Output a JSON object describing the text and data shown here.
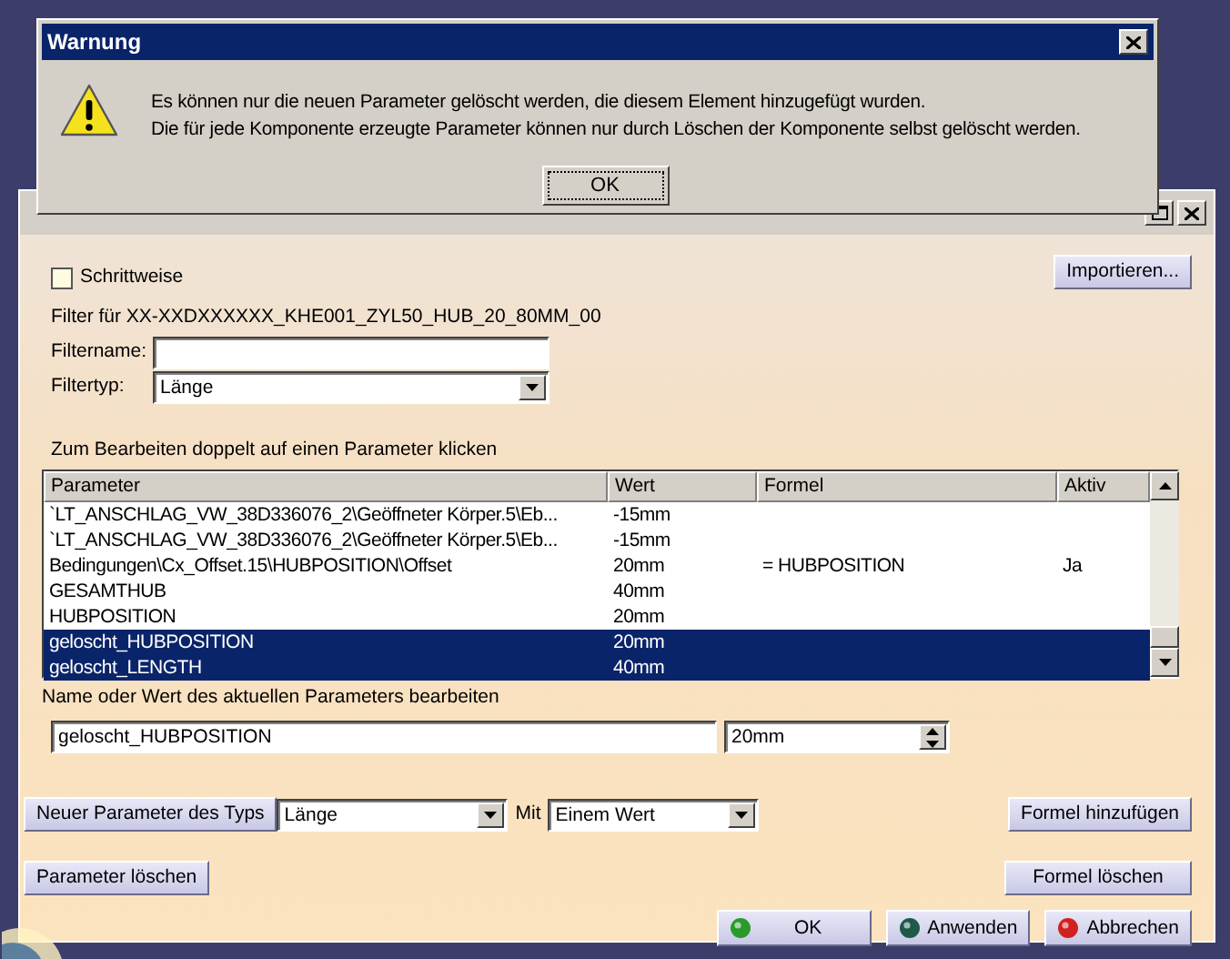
{
  "warning": {
    "title": "Warnung",
    "lines": [
      "Es können nur die neuen Parameter gelöscht werden, die diesem Element hinzugefügt wurden.",
      "Die für jede Komponente erzeugte Parameter können nur durch Löschen der Komponente selbst gelöscht werden."
    ],
    "ok_button": "OK"
  },
  "dialog": {
    "stepwise": {
      "label": "Schrittweise",
      "checked": false
    },
    "import_button": "Importieren...",
    "filter_title": "Filter für XX-XXDXXXXXX_KHE001_ZYL50_HUB_20_80MM_00",
    "filter_name": {
      "label": "Filtername:"
    },
    "filter_type": {
      "label": "Filtertyp:",
      "value": "Länge"
    },
    "table_hint": "Zum Bearbeiten doppelt auf einen Parameter klicken",
    "table": {
      "columns": [
        "Parameter",
        "Wert",
        "Formel",
        "Aktiv"
      ],
      "rows": [
        {
          "cells": [
            "`LT_ANSCHLAG_VW_38D336076_2\\Geöffneter Körper.5\\Eb...",
            "-15mm",
            "",
            ""
          ],
          "selected": false
        },
        {
          "cells": [
            "`LT_ANSCHLAG_VW_38D336076_2\\Geöffneter Körper.5\\Eb...",
            "-15mm",
            "",
            ""
          ],
          "selected": false
        },
        {
          "cells": [
            "Bedingungen\\Cx_Offset.15\\HUBPOSITION\\Offset",
            "20mm",
            "= HUBPOSITION",
            "Ja"
          ],
          "selected": false
        },
        {
          "cells": [
            "GESAMTHUB",
            "40mm",
            "",
            ""
          ],
          "selected": false
        },
        {
          "cells": [
            "HUBPOSITION",
            "20mm",
            "",
            ""
          ],
          "selected": false
        },
        {
          "cells": [
            "geloscht_HUBPOSITION",
            "20mm",
            "",
            ""
          ],
          "selected": true
        },
        {
          "cells": [
            "geloscht_LENGTH",
            "40mm",
            "",
            ""
          ],
          "selected": true
        }
      ]
    },
    "edit_label": "Name oder Wert des aktuellen Parameters bearbeiten",
    "name_value": "geloscht_HUBPOSITION",
    "value_value": "20mm",
    "new_param_button": "Neuer Parameter des Typs",
    "new_param_type": "Länge",
    "with_label": "Mit",
    "with_value": "Einem Wert",
    "add_formula_button": "Formel hinzufügen",
    "delete_param_button": "Parameter löschen",
    "delete_formula_button": "Formel löschen",
    "footer_buttons": [
      {
        "label": "OK",
        "kind": "ok"
      },
      {
        "label": "Anwenden",
        "kind": "apply"
      },
      {
        "label": "Abbrechen",
        "kind": "cancel"
      }
    ]
  }
}
